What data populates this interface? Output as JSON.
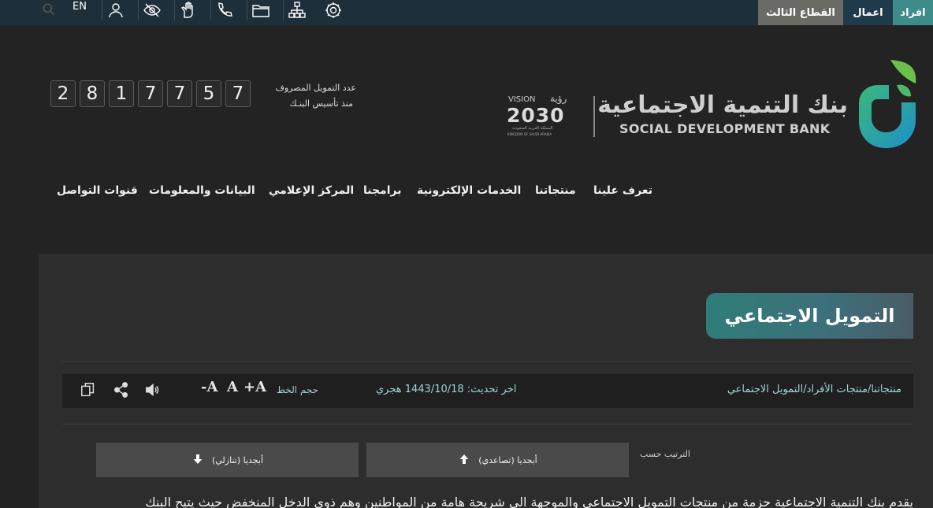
{
  "topbar": {
    "segments": [
      "افراد",
      "اعمال",
      "القطاع الثالث"
    ],
    "lang": "EN",
    "icons": [
      "settings-icon",
      "sitemap-icon",
      "folder-icon",
      "phone-icon",
      "sign-language-icon",
      "visibility-icon",
      "user-icon",
      "search-icon"
    ]
  },
  "header": {
    "bank_name_ar": "بنك التنمية الاجتماعية",
    "bank_name_en": "SOCIAL DEVELOPMENT BANK",
    "vision_label": "VISION",
    "vision_ar": "رؤية",
    "vision_year": "2030",
    "vision_kingdom_ar": "المملكة العربية السعودية",
    "vision_kingdom_en": "KINGDOM OF SAUDI ARABIA",
    "counter_label_line1": "عدد التمويل المصروف",
    "counter_label_line2": "منذ تأسيس البنـك",
    "counter_digits": [
      "2",
      "8",
      "1",
      "7",
      "7",
      "5",
      "7"
    ]
  },
  "nav": {
    "items": [
      "تعرف علينا",
      "منتجاتنا",
      "الخدمات الإلكترونية",
      "برامجنا",
      "المركز الإعلامي",
      "البيانات والمعلومات",
      "قنوات التواصل"
    ]
  },
  "page": {
    "title": "التمويل الاجتماعي",
    "breadcrumb": "منتجاتنا/منتجات الأفراد/التمويل الاجتماعي",
    "last_updated": "اخر تحديث: 1443/10/18 هجري",
    "font_size_label": "حجم الخط",
    "font_buttons": [
      "+A",
      "A",
      "-A"
    ],
    "sort_label": "الترتيب حسب",
    "sort_asc": "أبجديا (تصاعدي)",
    "sort_desc": "أبجديا (تنازلي)",
    "intro_text": "يقدم بنك التنمية الاجتماعية حزمة من منتجات التمويل الاجتماعي والموجهة الى شريحة هامة من المواطنين وهم ذوي الدخل المنخفض حيث يتيح البنك"
  },
  "colors": {
    "topbar": "#1d2f3b",
    "accent_teal": "#2f7d78",
    "link_teal": "#9ed3d6",
    "background": "#232323"
  }
}
